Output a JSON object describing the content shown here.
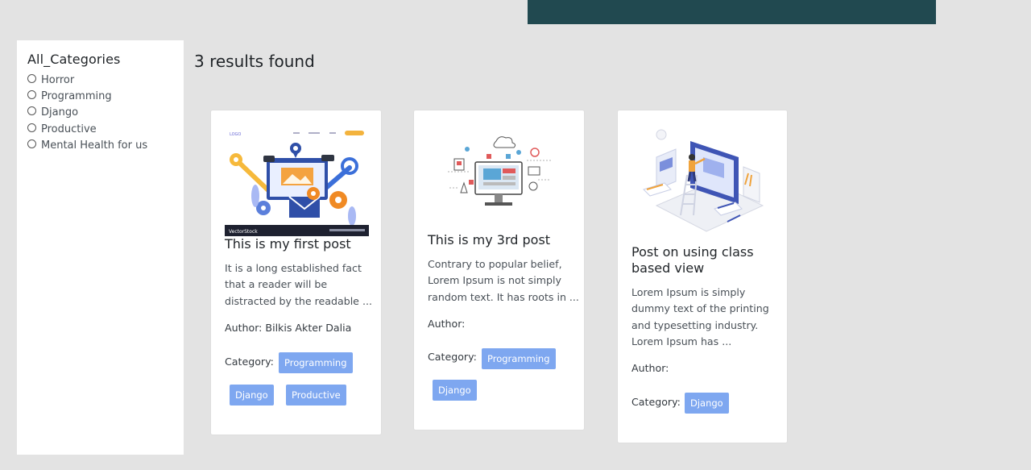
{
  "sidebar": {
    "title": "All_Categories",
    "categories": [
      "Horror",
      "Programming",
      "Django",
      "Productive",
      "Mental Health for us"
    ]
  },
  "results_text": "3 results found",
  "posts": [
    {
      "title": "This is my first post",
      "excerpt": [
        "It is a long established fact",
        "that a reader will be",
        "distracted by the readable ..."
      ],
      "author": "Author: Bilkis Akter Dalia",
      "category_label": "Category:",
      "categories": [
        "Programming",
        "Django",
        "Productive"
      ],
      "image_label": "VectorStock"
    },
    {
      "title": "This is my 3rd post",
      "excerpt": [
        "Contrary to popular belief,",
        "Lorem Ipsum is not simply",
        "random text. It has roots in ..."
      ],
      "author": "Author:",
      "category_label": "Category:",
      "categories": [
        "Programming",
        "Django"
      ]
    },
    {
      "title_lines": [
        "Post on using class",
        "based view"
      ],
      "excerpt": [
        "Lorem Ipsum is simply",
        "dummy text of the printing",
        "and typesetting industry.",
        "Lorem Ipsum has ..."
      ],
      "author": "Author:",
      "category_label": "Category:",
      "categories": [
        "Django"
      ]
    }
  ],
  "colors": {
    "page_bg": "#e3e3e3",
    "banner": "#214950",
    "badge": "#7ea7f0"
  }
}
